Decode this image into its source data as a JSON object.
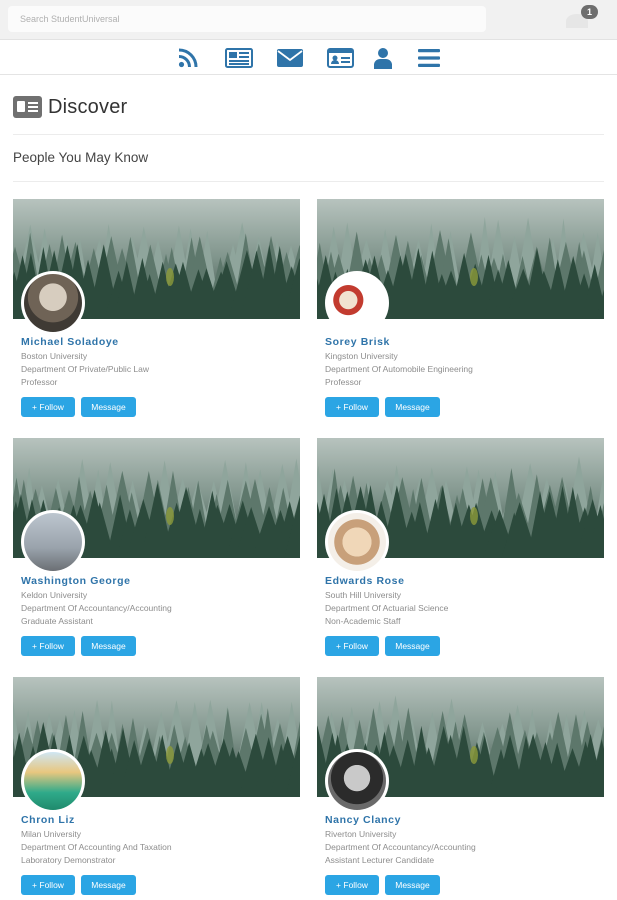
{
  "search": {
    "placeholder": "Search StudentUniversal"
  },
  "notifications": {
    "count": "1"
  },
  "nav": {
    "icons": [
      "rss-icon",
      "newspaper-icon",
      "envelope-icon",
      "id-card-icon",
      "user-icon",
      "menu-icon"
    ],
    "accent": "#2f74a9"
  },
  "page": {
    "title": "Discover",
    "section_title": "People You May Know"
  },
  "people": [
    {
      "name": "Michael Soladoye",
      "university": "Boston University",
      "department": "Department Of Private/Public Law",
      "role": "Professor",
      "follow": "+ Follow",
      "message": "Message"
    },
    {
      "name": "Sorey Brisk",
      "university": "Kingston University",
      "department": "Department Of Automobile Engineering",
      "role": "Professor",
      "follow": "+ Follow",
      "message": "Message"
    },
    {
      "name": "Washington George",
      "university": "Keldon University",
      "department": "Department Of Accountancy/Accounting",
      "role": "Graduate Assistant",
      "follow": "+ Follow",
      "message": "Message"
    },
    {
      "name": "Edwards Rose",
      "university": "South Hill University",
      "department": "Department Of Actuarial Science",
      "role": "Non-Academic Staff",
      "follow": "+ Follow",
      "message": "Message"
    },
    {
      "name": "Chron Liz",
      "university": "Milan University",
      "department": "Department Of Accounting And Taxation",
      "role": "Laboratory Demonstrator",
      "follow": "+ Follow",
      "message": "Message"
    },
    {
      "name": "Nancy Clancy",
      "university": "Riverton University",
      "department": "Department Of Accountancy/Accounting",
      "role": "Assistant Lecturer Candidate",
      "follow": "+ Follow",
      "message": "Message"
    }
  ],
  "colors": {
    "button": "#2ba5e4",
    "name": "#2f74a9"
  }
}
